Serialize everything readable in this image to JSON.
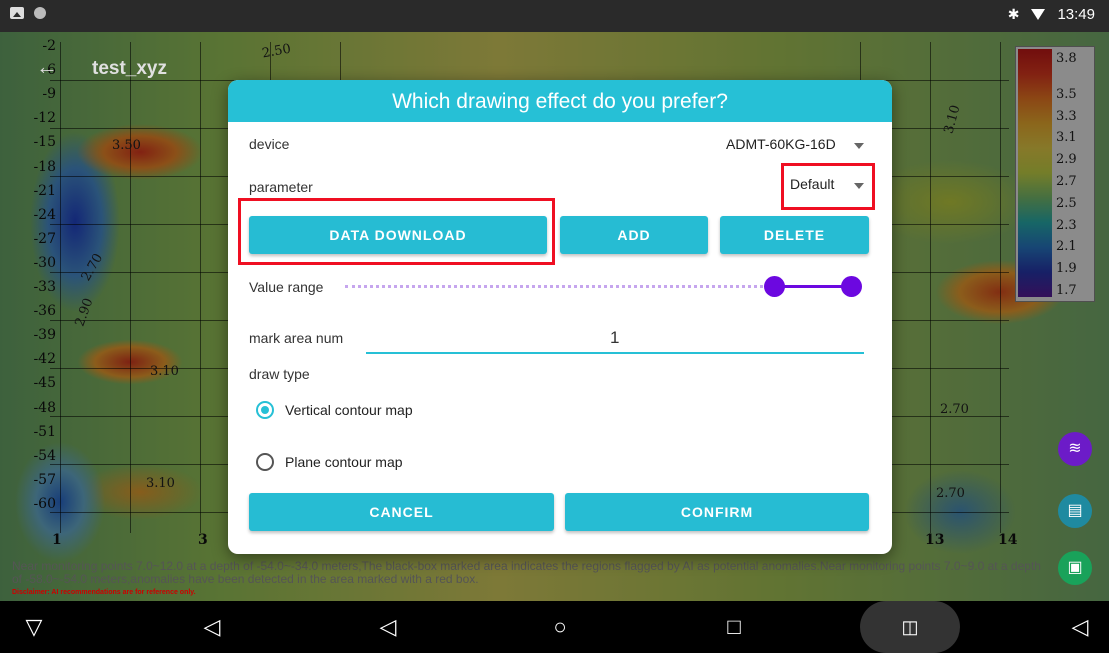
{
  "status_bar": {
    "time": "13:49",
    "bluetooth_icon": "bluetooth-icon",
    "wifi_icon": "wifi-icon"
  },
  "map": {
    "title": "test_xyz",
    "y_ticks": [
      "-2",
      "-6",
      "-9",
      "-12",
      "-15",
      "-18",
      "-21",
      "-24",
      "-27",
      "-30",
      "-33",
      "-36",
      "-39",
      "-42",
      "-45",
      "-48",
      "-51",
      "-54",
      "-57",
      "-60"
    ],
    "x_ticks": [
      "1",
      "3",
      "13",
      "14"
    ],
    "contour_labels": [
      "2.50",
      "3.10",
      "3.50",
      "2.70",
      "2.90",
      "3.10",
      "2.70",
      "2.70",
      "3.10"
    ],
    "legend_values": [
      "3.8",
      "3.5",
      "3.3",
      "3.1",
      "2.9",
      "2.7",
      "2.5",
      "2.3",
      "2.1",
      "1.9",
      "1.7"
    ],
    "footnote": "Near monitoring points 7.0~12.0 at a depth of -54.0~-34.0 meters,The black-box marked area indicates the regions flagged by AI as potential anomalies.Near monitoring points 7.0~9.0 at a depth of -58.0~-54.0 meters,anomalies have been detected in the area marked with a red box.",
    "disclaimer": "Disclaimer: AI recommendations are for reference only."
  },
  "dialog": {
    "title": "Which drawing effect do you prefer?",
    "device_label": "device",
    "device_value": "ADMT-60KG-16D",
    "parameter_label": "parameter",
    "parameter_value": "Default",
    "data_download_label": "DATA DOWNLOAD",
    "add_label": "ADD",
    "delete_label": "DELETE",
    "value_range_label": "Value range",
    "value_range": {
      "low": 0.83,
      "high": 0.97
    },
    "mark_area_label": "mark area num",
    "mark_area_value": "1",
    "draw_type_label": "draw type",
    "option_vertical": "Vertical contour map",
    "option_plane": "Plane contour map",
    "selected_option": "Vertical contour map",
    "cancel_label": "CANCEL",
    "confirm_label": "CONFIRM"
  },
  "colors": {
    "accent": "#26c0d6",
    "highlight": "#ef0f22",
    "slider": "#6c08e0"
  }
}
